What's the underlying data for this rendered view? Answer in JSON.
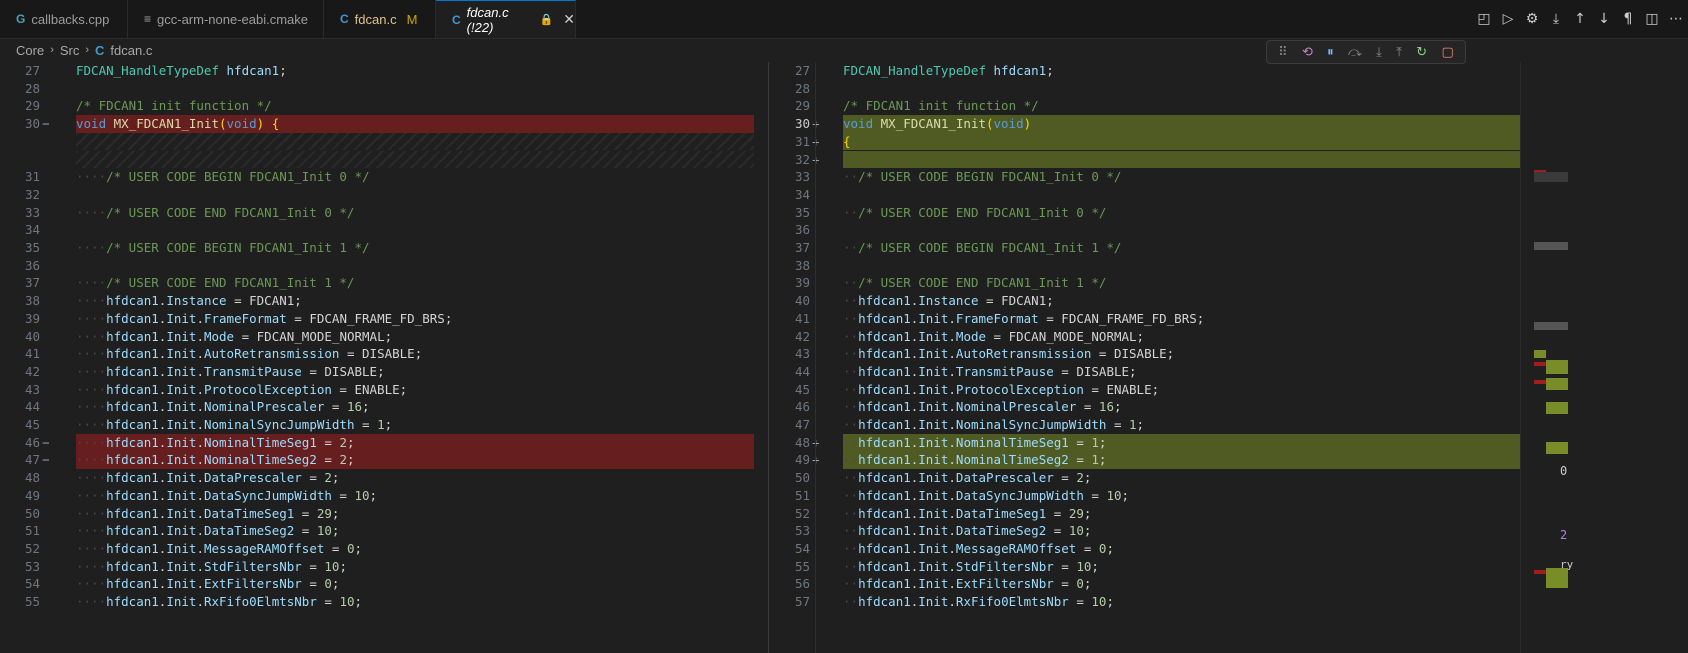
{
  "tabs": [
    {
      "label": "callbacks.cpp",
      "icon": "cpp-file-icon",
      "glyph": "G"
    },
    {
      "label": "gcc-arm-none-eabi.cmake",
      "icon": "cmake-file-icon",
      "glyph": "≡"
    },
    {
      "label": "fdcan.c",
      "icon": "c-file-icon",
      "glyph": "C",
      "status": "M"
    },
    {
      "label": "fdcan.c (!22)",
      "icon": "c-file-icon",
      "glyph": "C",
      "lock": "🔒",
      "close": "✕"
    }
  ],
  "breadcrumb": {
    "items": [
      "Core",
      "Src",
      "fdcan.c"
    ],
    "sep": "›",
    "file_icon": "C"
  },
  "editor_actions": [
    "◰",
    "▷",
    "⚙",
    "⤓",
    "↑",
    "↓",
    "¶",
    "◫",
    "⋯"
  ],
  "debug_toolbar": [
    "⠿",
    "⟲",
    "⏸",
    "⤼",
    "⤓",
    "⤒",
    "↻",
    "▢"
  ],
  "left_lines": [
    {
      "n": "27",
      "text": "FDCAN_HandleTypeDef hfdcan1;"
    },
    {
      "n": "28",
      "text": ""
    },
    {
      "n": "29",
      "text": "/* FDCAN1 init function */"
    },
    {
      "n": "30",
      "text": "void MX_FDCAN1_Init(void) {",
      "mark": "−",
      "diff": "del"
    },
    {
      "n": "",
      "text": "",
      "diff": "hatch"
    },
    {
      "n": "",
      "text": "",
      "diff": "hatch"
    },
    {
      "n": "31",
      "text": "····/* USER CODE BEGIN FDCAN1_Init 0 */"
    },
    {
      "n": "32",
      "text": ""
    },
    {
      "n": "33",
      "text": "····/* USER CODE END FDCAN1_Init 0 */"
    },
    {
      "n": "34",
      "text": ""
    },
    {
      "n": "35",
      "text": "····/* USER CODE BEGIN FDCAN1_Init 1 */"
    },
    {
      "n": "36",
      "text": ""
    },
    {
      "n": "37",
      "text": "····/* USER CODE END FDCAN1_Init 1 */"
    },
    {
      "n": "38",
      "text": "····hfdcan1.Instance = FDCAN1;"
    },
    {
      "n": "39",
      "text": "····hfdcan1.Init.FrameFormat = FDCAN_FRAME_FD_BRS;"
    },
    {
      "n": "40",
      "text": "····hfdcan1.Init.Mode = FDCAN_MODE_NORMAL;"
    },
    {
      "n": "41",
      "text": "····hfdcan1.Init.AutoRetransmission = DISABLE;"
    },
    {
      "n": "42",
      "text": "····hfdcan1.Init.TransmitPause = DISABLE;"
    },
    {
      "n": "43",
      "text": "····hfdcan1.Init.ProtocolException = ENABLE;"
    },
    {
      "n": "44",
      "text": "····hfdcan1.Init.NominalPrescaler = 16;"
    },
    {
      "n": "45",
      "text": "····hfdcan1.Init.NominalSyncJumpWidth = 1;"
    },
    {
      "n": "46",
      "text": "····hfdcan1.Init.NominalTimeSeg1 = 2;",
      "mark": "−",
      "diff": "del"
    },
    {
      "n": "47",
      "text": "····hfdcan1.Init.NominalTimeSeg2 = 2;",
      "mark": "−",
      "diff": "del"
    },
    {
      "n": "48",
      "text": "····hfdcan1.Init.DataPrescaler = 2;"
    },
    {
      "n": "49",
      "text": "····hfdcan1.Init.DataSyncJumpWidth = 10;"
    },
    {
      "n": "50",
      "text": "····hfdcan1.Init.DataTimeSeg1 = 29;"
    },
    {
      "n": "51",
      "text": "····hfdcan1.Init.DataTimeSeg2 = 10;"
    },
    {
      "n": "52",
      "text": "····hfdcan1.Init.MessageRAMOffset = 0;"
    },
    {
      "n": "53",
      "text": "····hfdcan1.Init.StdFiltersNbr = 10;"
    },
    {
      "n": "54",
      "text": "····hfdcan1.Init.ExtFiltersNbr = 0;"
    },
    {
      "n": "55",
      "text": "····hfdcan1.Init.RxFifo0ElmtsNbr = 10;"
    }
  ],
  "right_lines": [
    {
      "n": "27",
      "text": "FDCAN_HandleTypeDef hfdcan1;"
    },
    {
      "n": "28",
      "text": ""
    },
    {
      "n": "29",
      "text": "/* FDCAN1 init function */"
    },
    {
      "n": "30",
      "text": "void MX_FDCAN1_Init(void)",
      "mark": "+",
      "diff": "add"
    },
    {
      "n": "31",
      "text": "{",
      "mark": "+",
      "diff": "add"
    },
    {
      "n": "32",
      "text": "",
      "mark": "+",
      "diff": "add"
    },
    {
      "n": "33",
      "text": "··/* USER CODE BEGIN FDCAN1_Init 0 */"
    },
    {
      "n": "34",
      "text": ""
    },
    {
      "n": "35",
      "text": "··/* USER CODE END FDCAN1_Init 0 */"
    },
    {
      "n": "36",
      "text": ""
    },
    {
      "n": "37",
      "text": "··/* USER CODE BEGIN FDCAN1_Init 1 */"
    },
    {
      "n": "38",
      "text": ""
    },
    {
      "n": "39",
      "text": "··/* USER CODE END FDCAN1_Init 1 */"
    },
    {
      "n": "40",
      "text": "··hfdcan1.Instance = FDCAN1;"
    },
    {
      "n": "41",
      "text": "··hfdcan1.Init.FrameFormat = FDCAN_FRAME_FD_BRS;"
    },
    {
      "n": "42",
      "text": "··hfdcan1.Init.Mode = FDCAN_MODE_NORMAL;"
    },
    {
      "n": "43",
      "text": "··hfdcan1.Init.AutoRetransmission = DISABLE;"
    },
    {
      "n": "44",
      "text": "··hfdcan1.Init.TransmitPause = DISABLE;"
    },
    {
      "n": "45",
      "text": "··hfdcan1.Init.ProtocolException = ENABLE;"
    },
    {
      "n": "46",
      "text": "··hfdcan1.Init.NominalPrescaler = 16;"
    },
    {
      "n": "47",
      "text": "··hfdcan1.Init.NominalSyncJumpWidth = 1;"
    },
    {
      "n": "48",
      "text": "··hfdcan1.Init.NominalTimeSeg1 = 1;",
      "mark": "+",
      "diff": "add"
    },
    {
      "n": "49",
      "text": "··hfdcan1.Init.NominalTimeSeg2 = 1;",
      "mark": "+",
      "diff": "add"
    },
    {
      "n": "50",
      "text": "··hfdcan1.Init.DataPrescaler = 2;"
    },
    {
      "n": "51",
      "text": "··hfdcan1.Init.DataSyncJumpWidth = 10;"
    },
    {
      "n": "52",
      "text": "··hfdcan1.Init.DataTimeSeg1 = 29;"
    },
    {
      "n": "53",
      "text": "··hfdcan1.Init.DataTimeSeg2 = 10;"
    },
    {
      "n": "54",
      "text": "··hfdcan1.Init.MessageRAMOffset = 0;"
    },
    {
      "n": "55",
      "text": "··hfdcan1.Init.StdFiltersNbr = 10;"
    },
    {
      "n": "56",
      "text": "··hfdcan1.Init.ExtFiltersNbr = 0;"
    },
    {
      "n": "57",
      "text": "··hfdcan1.Init.RxFifo0ElmtsNbr = 10;"
    }
  ],
  "right_edge_text": {
    "zero": "0",
    "two": "2",
    "ry": "ry"
  },
  "colors": {
    "deleted": "#a01e1e",
    "added": "#788c28",
    "accent": "#0078d4"
  }
}
